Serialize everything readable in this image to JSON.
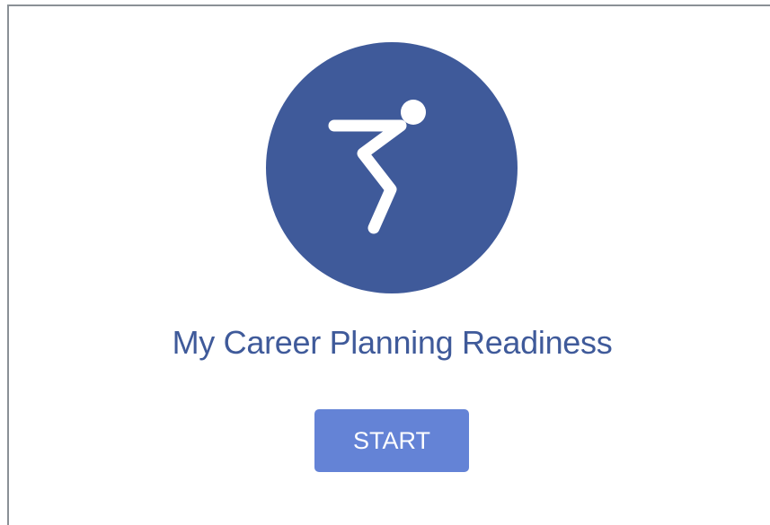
{
  "activity": {
    "icon": "person-squat-icon",
    "title": "My Career Planning Readiness",
    "start_label": "START"
  },
  "colors": {
    "circle": "#3f5a9a",
    "title": "#3f5a9a",
    "button": "#6483d6",
    "button_text": "#ffffff"
  }
}
